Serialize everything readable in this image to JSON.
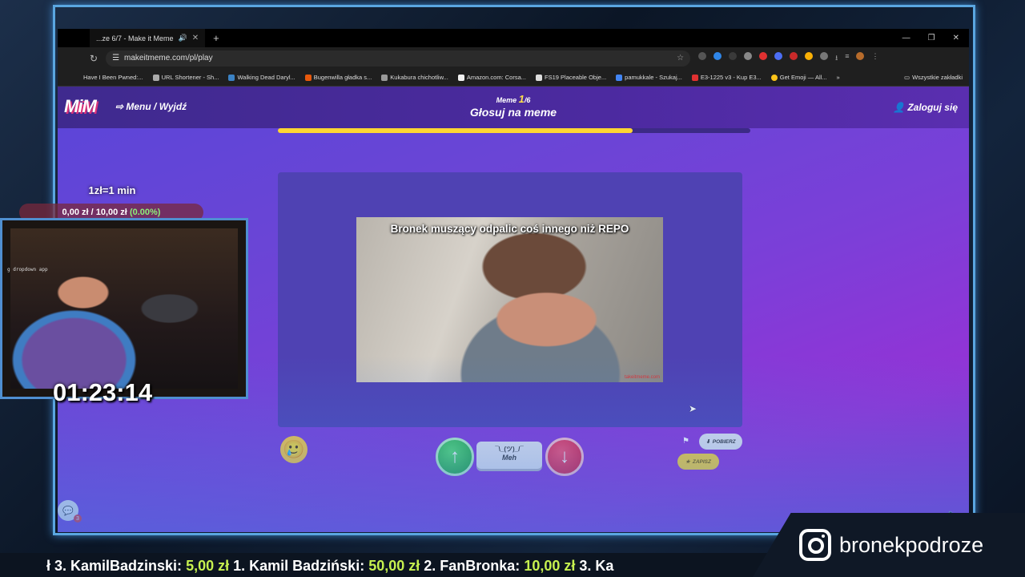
{
  "browser": {
    "tab_title": "...ze 6/7 - Make it Meme",
    "url": "makeitmeme.com/pl/play",
    "bookmarks": [
      "Have I Been Pwned:...",
      "URL Shortener - Sh...",
      "Walking Dead Daryl...",
      "Bugenwilla gładka s...",
      "Kukabura chichotliw...",
      "Amazon.com: Corsa...",
      "FS19 Placeable Obje...",
      "pamukkale - Szukaj...",
      "E3-1225 v3 - Kup E3...",
      "Get Emoji — All...",
      "Wszystkie zakładki"
    ]
  },
  "site": {
    "logo": "MiM",
    "menu_label": "Menu / Wyjdź",
    "meme_label": "Meme",
    "meme_current": "1",
    "meme_total": "/6",
    "vote_title": "Głosuj na meme",
    "login_label": "Zaloguj się",
    "progress_fraction": 0.75
  },
  "meme": {
    "caption": "Bronek muszący odpalic coś innego niż REPO",
    "watermark": "takeitmeme.com"
  },
  "controls": {
    "meh_face": "¯\\_(ツ)_/¯",
    "meh_label": "Meh",
    "download_label": "POBIERZ",
    "save_label": "ZAPISZ",
    "chat_badge": "3"
  },
  "overlay": {
    "donation_rate": "1zł=1 min",
    "donation_progress": "0,00 zł / 10,00 zł",
    "donation_percent": "(0.00%)",
    "webcam_text": "g dropdown app",
    "timer": "01:23:14",
    "instagram_handle": "bronekpodroze",
    "ticker": [
      {
        "name": "ł 3. KamilBadzinski:",
        "amount": "5,00 zł"
      },
      {
        "name": "1. Kamil Badziński:",
        "amount": "50,00 zł"
      },
      {
        "name": "2. FanBronka:",
        "amount": "10,00 zł"
      },
      {
        "name": "3. Ka",
        "amount": ""
      }
    ]
  }
}
